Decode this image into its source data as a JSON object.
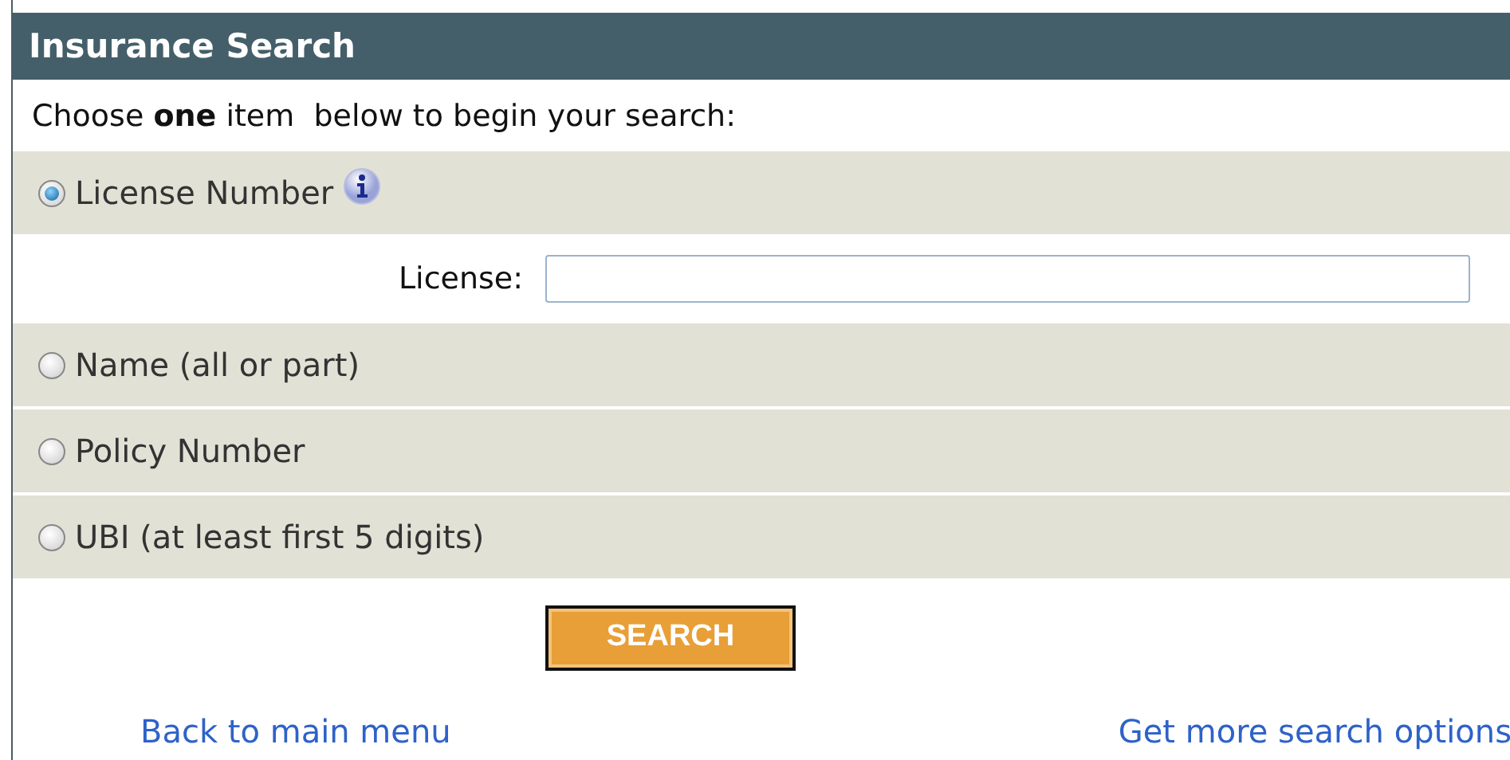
{
  "header": {
    "title": "Insurance Search"
  },
  "instruction": "Choose **one** item  below to begin your search:",
  "options": [
    {
      "label": "License Number",
      "selected": true,
      "info": true
    },
    {
      "label": "Name (all or part)",
      "selected": false,
      "info": false
    },
    {
      "label": "Policy Number",
      "selected": false,
      "info": false
    },
    {
      "label": "UBI (at least first 5 digits)",
      "selected": false,
      "info": false
    }
  ],
  "license_field": {
    "label": "License:"
  },
  "search_button": "SEARCH",
  "links": [
    "Back to main menu",
    "Get more search options"
  ]
}
